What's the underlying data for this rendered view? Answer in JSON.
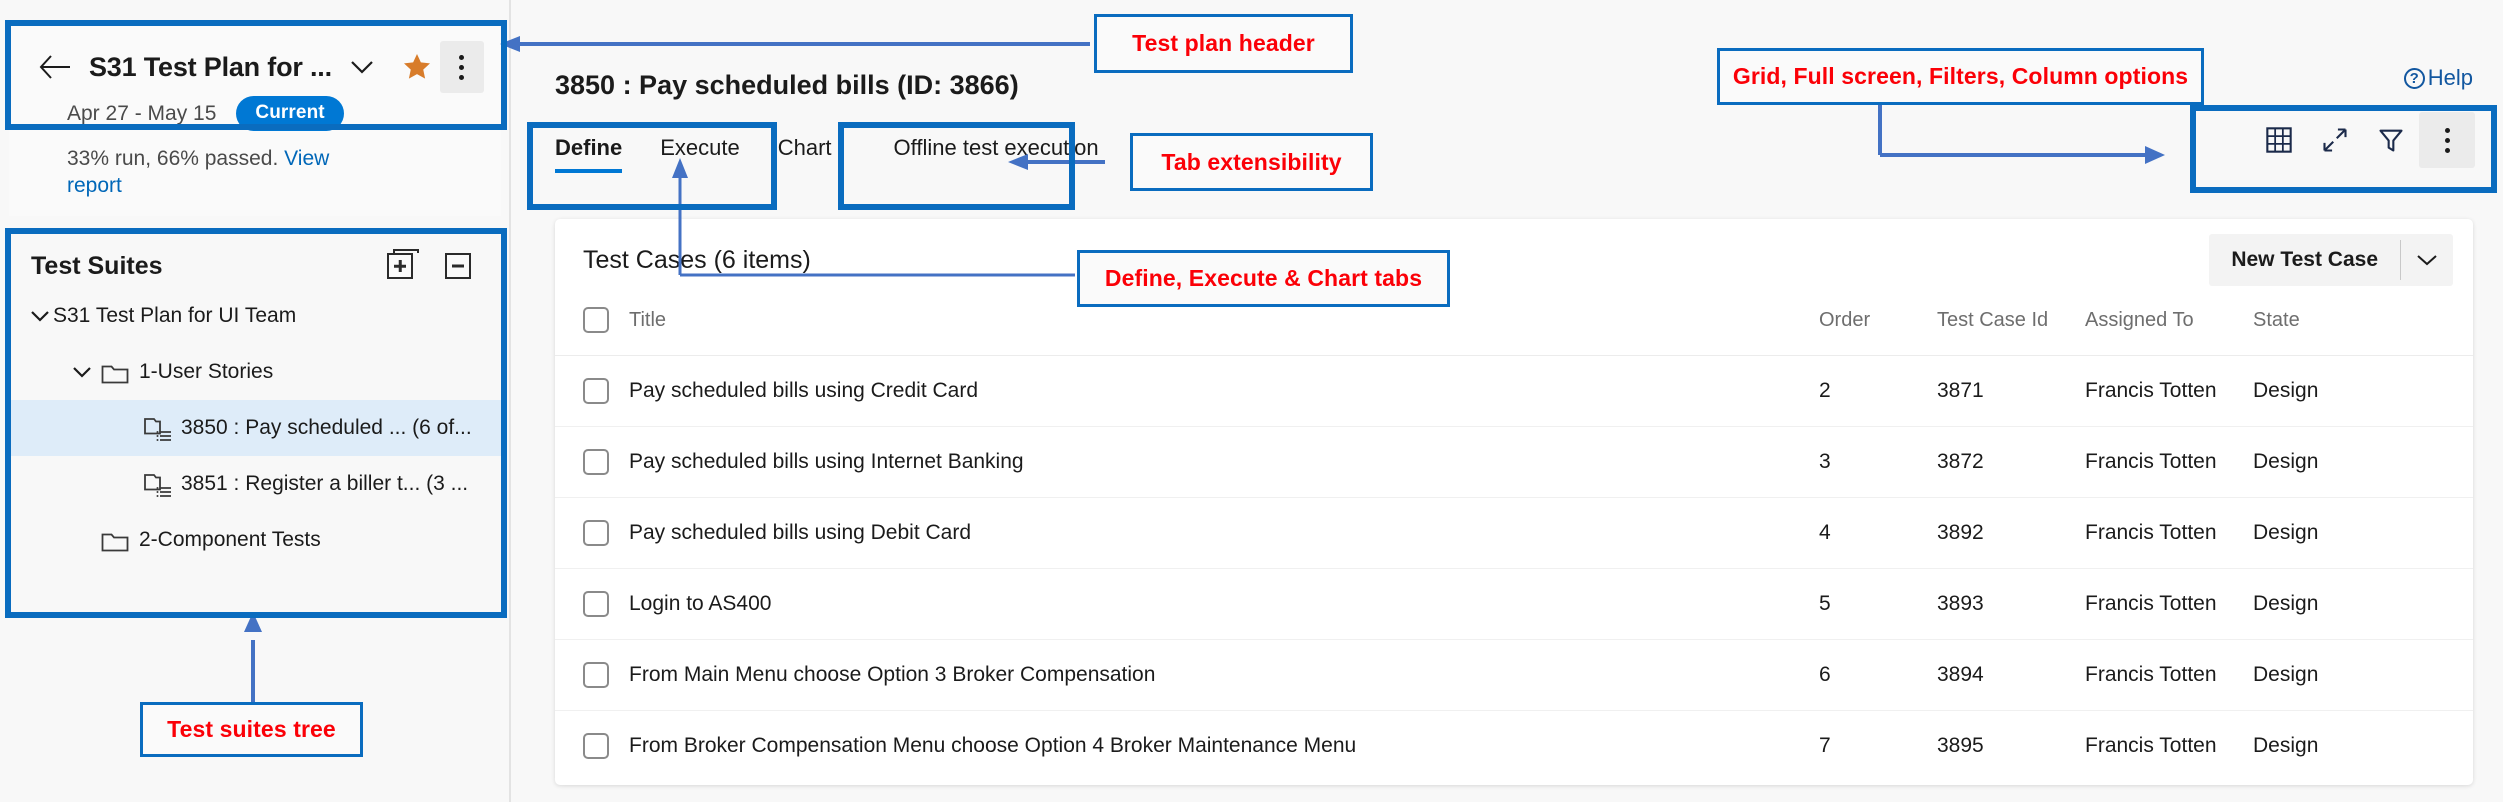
{
  "plan_header": {
    "back_icon": "back-arrow-icon",
    "title": "S31 Test Plan for ...",
    "chevron_icon": "chevron-down-icon",
    "star_icon": "star-icon",
    "more_icon": "more-vertical-icon",
    "dates": "Apr 27 - May 15",
    "badge": "Current",
    "progress_text": "33% run, 66% passed.",
    "view_report_link": "View report"
  },
  "suites": {
    "title": "Test Suites",
    "expand_icon": "expand-all-icon",
    "collapse_icon": "collapse-all-icon",
    "tree": [
      {
        "label": "S31 Test Plan for UI Team",
        "depth": 0,
        "type": "root",
        "expanded": true,
        "selected": false
      },
      {
        "label": "1-User Stories",
        "depth": 1,
        "type": "folder",
        "expanded": true,
        "selected": false
      },
      {
        "label": "3850 : Pay scheduled ...  (6 of...",
        "depth": 2,
        "type": "requirement",
        "expanded": false,
        "selected": true
      },
      {
        "label": "3851 : Register a biller t... (3 ...",
        "depth": 2,
        "type": "requirement",
        "expanded": false,
        "selected": false
      },
      {
        "label": "2-Component Tests",
        "depth": 1,
        "type": "folder",
        "expanded": false,
        "selected": false
      }
    ]
  },
  "main": {
    "breadcrumb_title": "3850 : Pay scheduled bills (ID: 3866)",
    "tabs": [
      {
        "label": "Define",
        "active": true
      },
      {
        "label": "Execute",
        "active": false
      },
      {
        "label": "Chart",
        "active": false
      }
    ],
    "extensibility_tab": "Offline test execution",
    "help_label": "Help",
    "help_icon": "question-circle-icon",
    "toolbar": [
      {
        "name": "grid-icon",
        "pressed": false
      },
      {
        "name": "full-screen-icon",
        "pressed": false
      },
      {
        "name": "filter-icon",
        "pressed": false
      },
      {
        "name": "column-options-icon",
        "pressed": true
      }
    ]
  },
  "cases": {
    "heading": "Test Cases (6 items)",
    "new_button": "New Test Case",
    "new_button_chevron": "chevron-down-icon",
    "columns": [
      "",
      "Title",
      "Order",
      "Test Case Id",
      "Assigned To",
      "State"
    ],
    "rows": [
      {
        "title": "Pay scheduled bills using Credit Card",
        "order": "2",
        "test_case_id": "3871",
        "assigned_to": "Francis Totten",
        "state": "Design"
      },
      {
        "title": "Pay scheduled bills using Internet Banking",
        "order": "3",
        "test_case_id": "3872",
        "assigned_to": "Francis Totten",
        "state": "Design"
      },
      {
        "title": "Pay scheduled bills using Debit Card",
        "order": "4",
        "test_case_id": "3892",
        "assigned_to": "Francis Totten",
        "state": "Design"
      },
      {
        "title": "Login to AS400",
        "order": "5",
        "test_case_id": "3893",
        "assigned_to": "Francis Totten",
        "state": "Design"
      },
      {
        "title": "From Main Menu choose Option 3 Broker Compensation",
        "order": "6",
        "test_case_id": "3894",
        "assigned_to": "Francis Totten",
        "state": "Design"
      },
      {
        "title": "From Broker Compensation Menu choose Option 4 Broker Maintenance Menu",
        "order": "7",
        "test_case_id": "3895",
        "assigned_to": "Francis Totten",
        "state": "Design"
      }
    ]
  },
  "annotations": {
    "test_plan_header": "Test plan header",
    "grid_options": "Grid, Full screen, Filters, Column options",
    "tab_extensibility": "Tab extensibility",
    "define_execute_chart": "Define, Execute & Chart tabs",
    "test_suites_tree": "Test suites tree"
  },
  "colors": {
    "accent": "#0078d4",
    "annotation_box": "#0a6cbf",
    "annotation_text": "#fb0007",
    "star": "#d87c2a",
    "selected_row": "#deecf9",
    "link": "#0067b8"
  }
}
